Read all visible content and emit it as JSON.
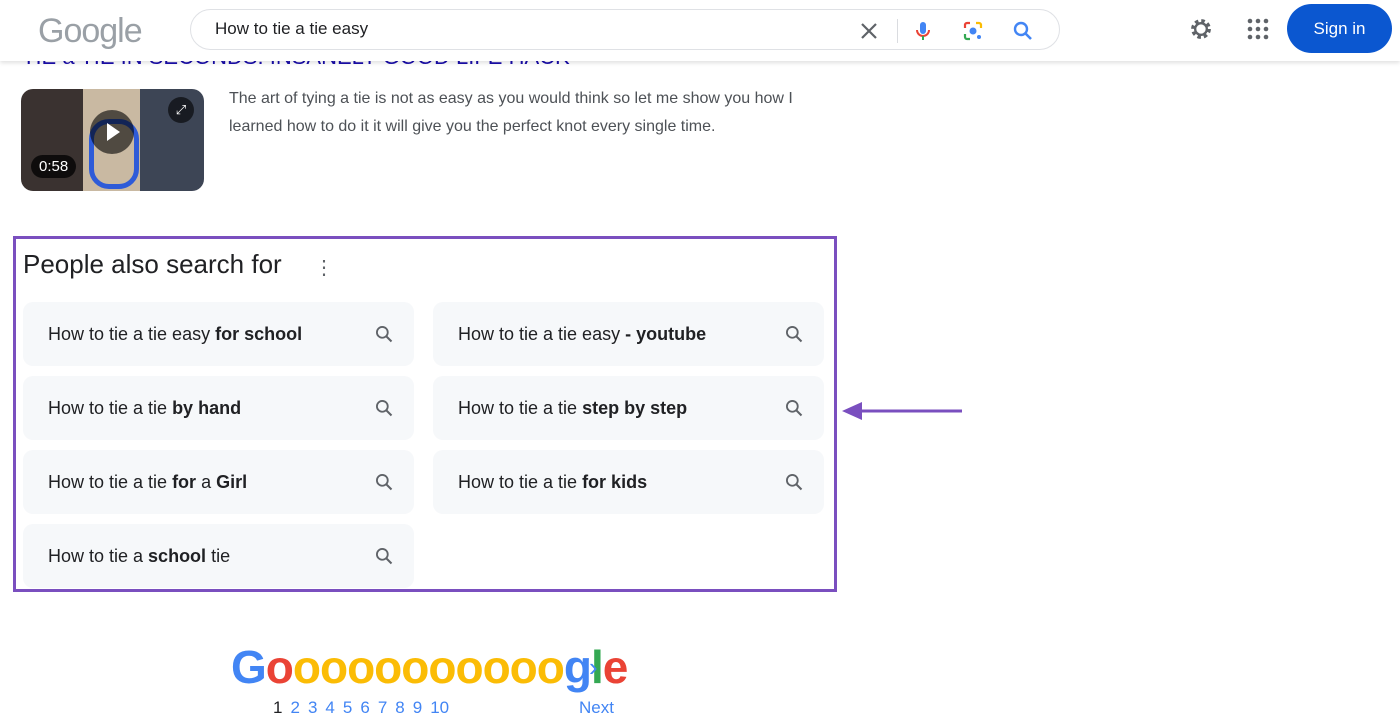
{
  "header": {
    "logo": "Google",
    "query": "How to tie a tie easy",
    "sign_in": "Sign in"
  },
  "result": {
    "title": "TIE a TIE IN SECONDS: INSANELY GOOD LIFE HACK",
    "duration": "0:58",
    "snippet": "The art of tying a tie is not as easy as you would think so let me show you how I learned how to do it it will give you the perfect knot every single time."
  },
  "pasf": {
    "heading": "People also search for",
    "items": [
      {
        "prefix": "How to tie a tie easy ",
        "bold": "for school",
        "suffix": ""
      },
      {
        "prefix": "How to tie a tie easy ",
        "bold": "- youtube",
        "suffix": ""
      },
      {
        "prefix": "How to tie a tie ",
        "bold": "by hand",
        "suffix": ""
      },
      {
        "prefix": "How to tie a tie ",
        "bold": "step by step",
        "suffix": ""
      },
      {
        "prefix": "How to tie a tie ",
        "bold": "for",
        "suffix": " a ",
        "bold2": "Girl"
      },
      {
        "prefix": "How to tie a tie ",
        "bold": "for kids",
        "suffix": ""
      },
      {
        "prefix": "How to tie a ",
        "bold": "school",
        "suffix": " tie"
      }
    ],
    "highlight_color": "#7a4fbf"
  },
  "pagination": {
    "pages": [
      "1",
      "2",
      "3",
      "4",
      "5",
      "6",
      "7",
      "8",
      "9",
      "10"
    ],
    "current": "1",
    "next": "Next"
  }
}
